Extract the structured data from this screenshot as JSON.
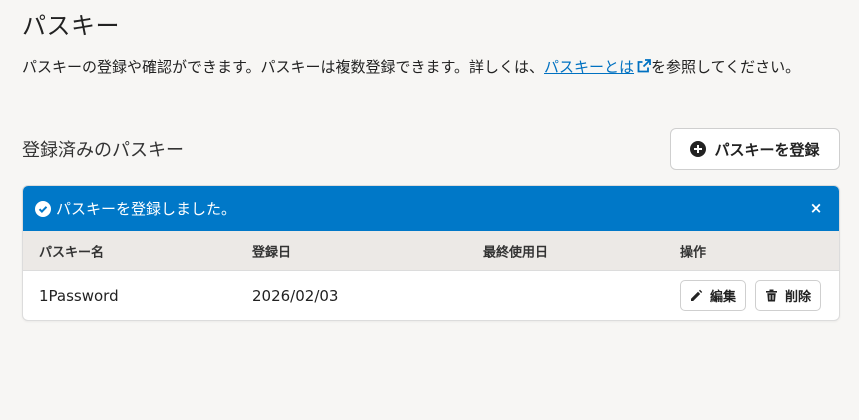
{
  "page": {
    "title": "パスキー",
    "description_before": "パスキーの登録や確認ができます。パスキーは複数登録できます。詳しくは、",
    "description_link": "パスキーとは",
    "description_after": "を参照してください。"
  },
  "section": {
    "title": "登録済みのパスキー",
    "register_label": "パスキーを登録"
  },
  "alert": {
    "message": "パスキーを登録しました。",
    "close_label": "×"
  },
  "table": {
    "headers": [
      "パスキー名",
      "登録日",
      "最終使用日",
      "操作"
    ],
    "rows": [
      {
        "name": "1Password",
        "registered": "2026/02/03",
        "last_used": "",
        "edit_label": "編集",
        "delete_label": "削除"
      }
    ]
  },
  "colors": {
    "alert_bg": "#0078c8",
    "link": "#0071c1",
    "page_bg": "#f7f6f4",
    "header_bg": "#ece9e6"
  },
  "icons": {
    "register": "plus-circle-icon",
    "link": "external-link-icon",
    "alert": "check-circle-icon",
    "edit": "pencil-icon",
    "delete": "trash-icon"
  }
}
